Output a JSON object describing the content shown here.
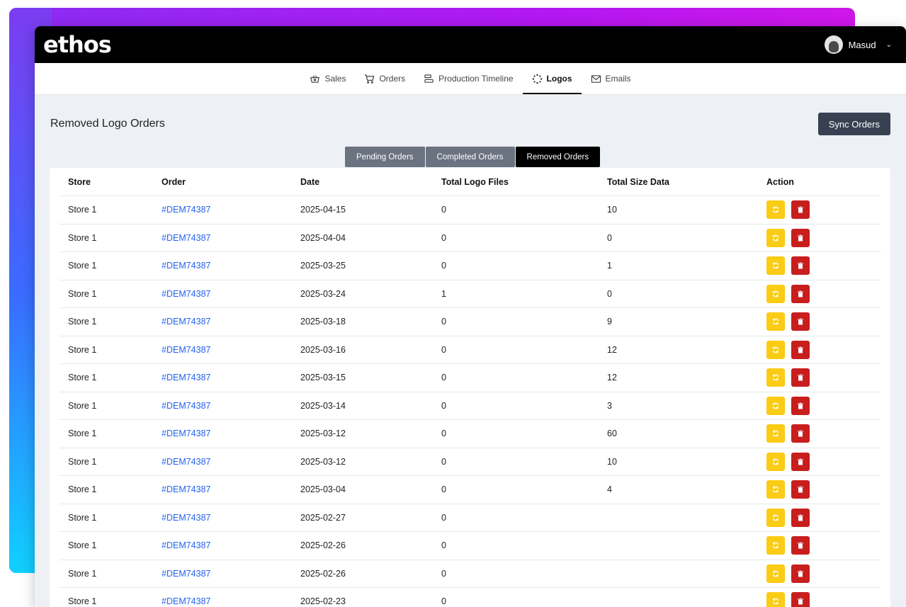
{
  "app": {
    "brand": "ethos"
  },
  "user": {
    "name": "Masud"
  },
  "nav": [
    {
      "label": "Sales",
      "icon": "basket-icon",
      "active": false
    },
    {
      "label": "Orders",
      "icon": "cart-icon",
      "active": false
    },
    {
      "label": "Production Timeline",
      "icon": "timeline-icon",
      "active": false
    },
    {
      "label": "Logos",
      "icon": "sparkle-icon",
      "active": true
    },
    {
      "label": "Emails",
      "icon": "mail-icon",
      "active": false
    }
  ],
  "page": {
    "title": "Removed Logo Orders",
    "sync_label": "Sync Orders"
  },
  "tabs": [
    {
      "label": "Pending Orders",
      "active": false
    },
    {
      "label": "Completed Orders",
      "active": false
    },
    {
      "label": "Removed Orders",
      "active": true
    }
  ],
  "table": {
    "columns": [
      "Store",
      "Order",
      "Date",
      "Total Logo Files",
      "Total Size Data",
      "Action"
    ],
    "rows": [
      {
        "store": "Store 1",
        "order": "#DEM74387",
        "date": "2025-04-15",
        "files": "0",
        "size": "10"
      },
      {
        "store": "Store 1",
        "order": "#DEM74387",
        "date": "2025-04-04",
        "files": "0",
        "size": "0"
      },
      {
        "store": "Store 1",
        "order": "#DEM74387",
        "date": "2025-03-25",
        "files": "0",
        "size": "1"
      },
      {
        "store": "Store 1",
        "order": "#DEM74387",
        "date": "2025-03-24",
        "files": "1",
        "size": "0"
      },
      {
        "store": "Store 1",
        "order": "#DEM74387",
        "date": "2025-03-18",
        "files": "0",
        "size": "9"
      },
      {
        "store": "Store 1",
        "order": "#DEM74387",
        "date": "2025-03-16",
        "files": "0",
        "size": "12"
      },
      {
        "store": "Store 1",
        "order": "#DEM74387",
        "date": "2025-03-15",
        "files": "0",
        "size": "12"
      },
      {
        "store": "Store 1",
        "order": "#DEM74387",
        "date": "2025-03-14",
        "files": "0",
        "size": "3"
      },
      {
        "store": "Store 1",
        "order": "#DEM74387",
        "date": "2025-03-12",
        "files": "0",
        "size": "60"
      },
      {
        "store": "Store 1",
        "order": "#DEM74387",
        "date": "2025-03-12",
        "files": "0",
        "size": "10"
      },
      {
        "store": "Store 1",
        "order": "#DEM74387",
        "date": "2025-03-04",
        "files": "0",
        "size": "4"
      },
      {
        "store": "Store 1",
        "order": "#DEM74387",
        "date": "2025-02-27",
        "files": "0",
        "size": ""
      },
      {
        "store": "Store 1",
        "order": "#DEM74387",
        "date": "2025-02-26",
        "files": "0",
        "size": ""
      },
      {
        "store": "Store 1",
        "order": "#DEM74387",
        "date": "2025-02-26",
        "files": "0",
        "size": ""
      },
      {
        "store": "Store 1",
        "order": "#DEM74387",
        "date": "2025-02-23",
        "files": "0",
        "size": ""
      }
    ]
  },
  "colors": {
    "restore": "#facc15",
    "delete": "#c81e1e",
    "link": "#2563eb",
    "topbar": "#000000"
  }
}
